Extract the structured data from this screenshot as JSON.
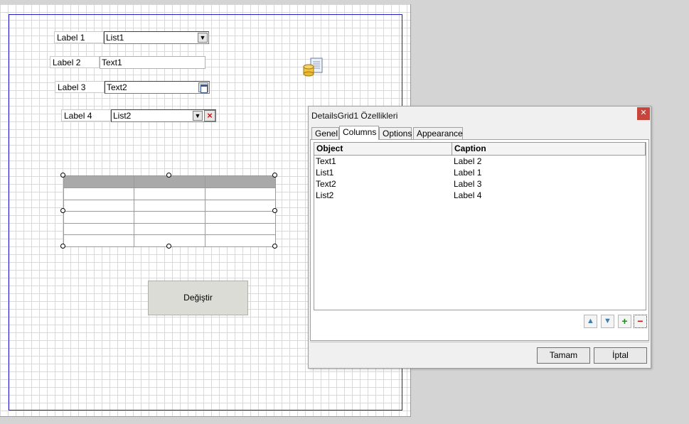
{
  "form": {
    "rows": [
      {
        "label": "Label 1",
        "value": "List1",
        "kind": "dropdown"
      },
      {
        "label": "Label 2",
        "value": "Text1",
        "kind": "text"
      },
      {
        "label": "Label 3",
        "value": "Text2",
        "kind": "date"
      },
      {
        "label": "Label 4",
        "value": "List2",
        "kind": "dropdown-clear"
      }
    ],
    "button_label": "Değiştir",
    "database_icon": "database-form-icon"
  },
  "dialog": {
    "title": "DetailsGrid1 Özellikleri",
    "close_icon": "close-icon",
    "tabs": [
      "Genel",
      "Columns",
      "Options",
      "Appearance"
    ],
    "active_tab": "Columns",
    "columns_header": {
      "object": "Object",
      "caption": "Caption"
    },
    "rows": [
      {
        "object": "Text1",
        "caption": "Label 2"
      },
      {
        "object": "List1",
        "caption": "Label 1"
      },
      {
        "object": "Text2",
        "caption": "Label 3"
      },
      {
        "object": "List2",
        "caption": "Label 4"
      }
    ],
    "tools": {
      "move_up": "▲",
      "move_down": "▼",
      "add": "+",
      "remove": "−"
    },
    "ok_label": "Tamam",
    "cancel_label": "İptal",
    "accent_close": "#c7453b"
  }
}
